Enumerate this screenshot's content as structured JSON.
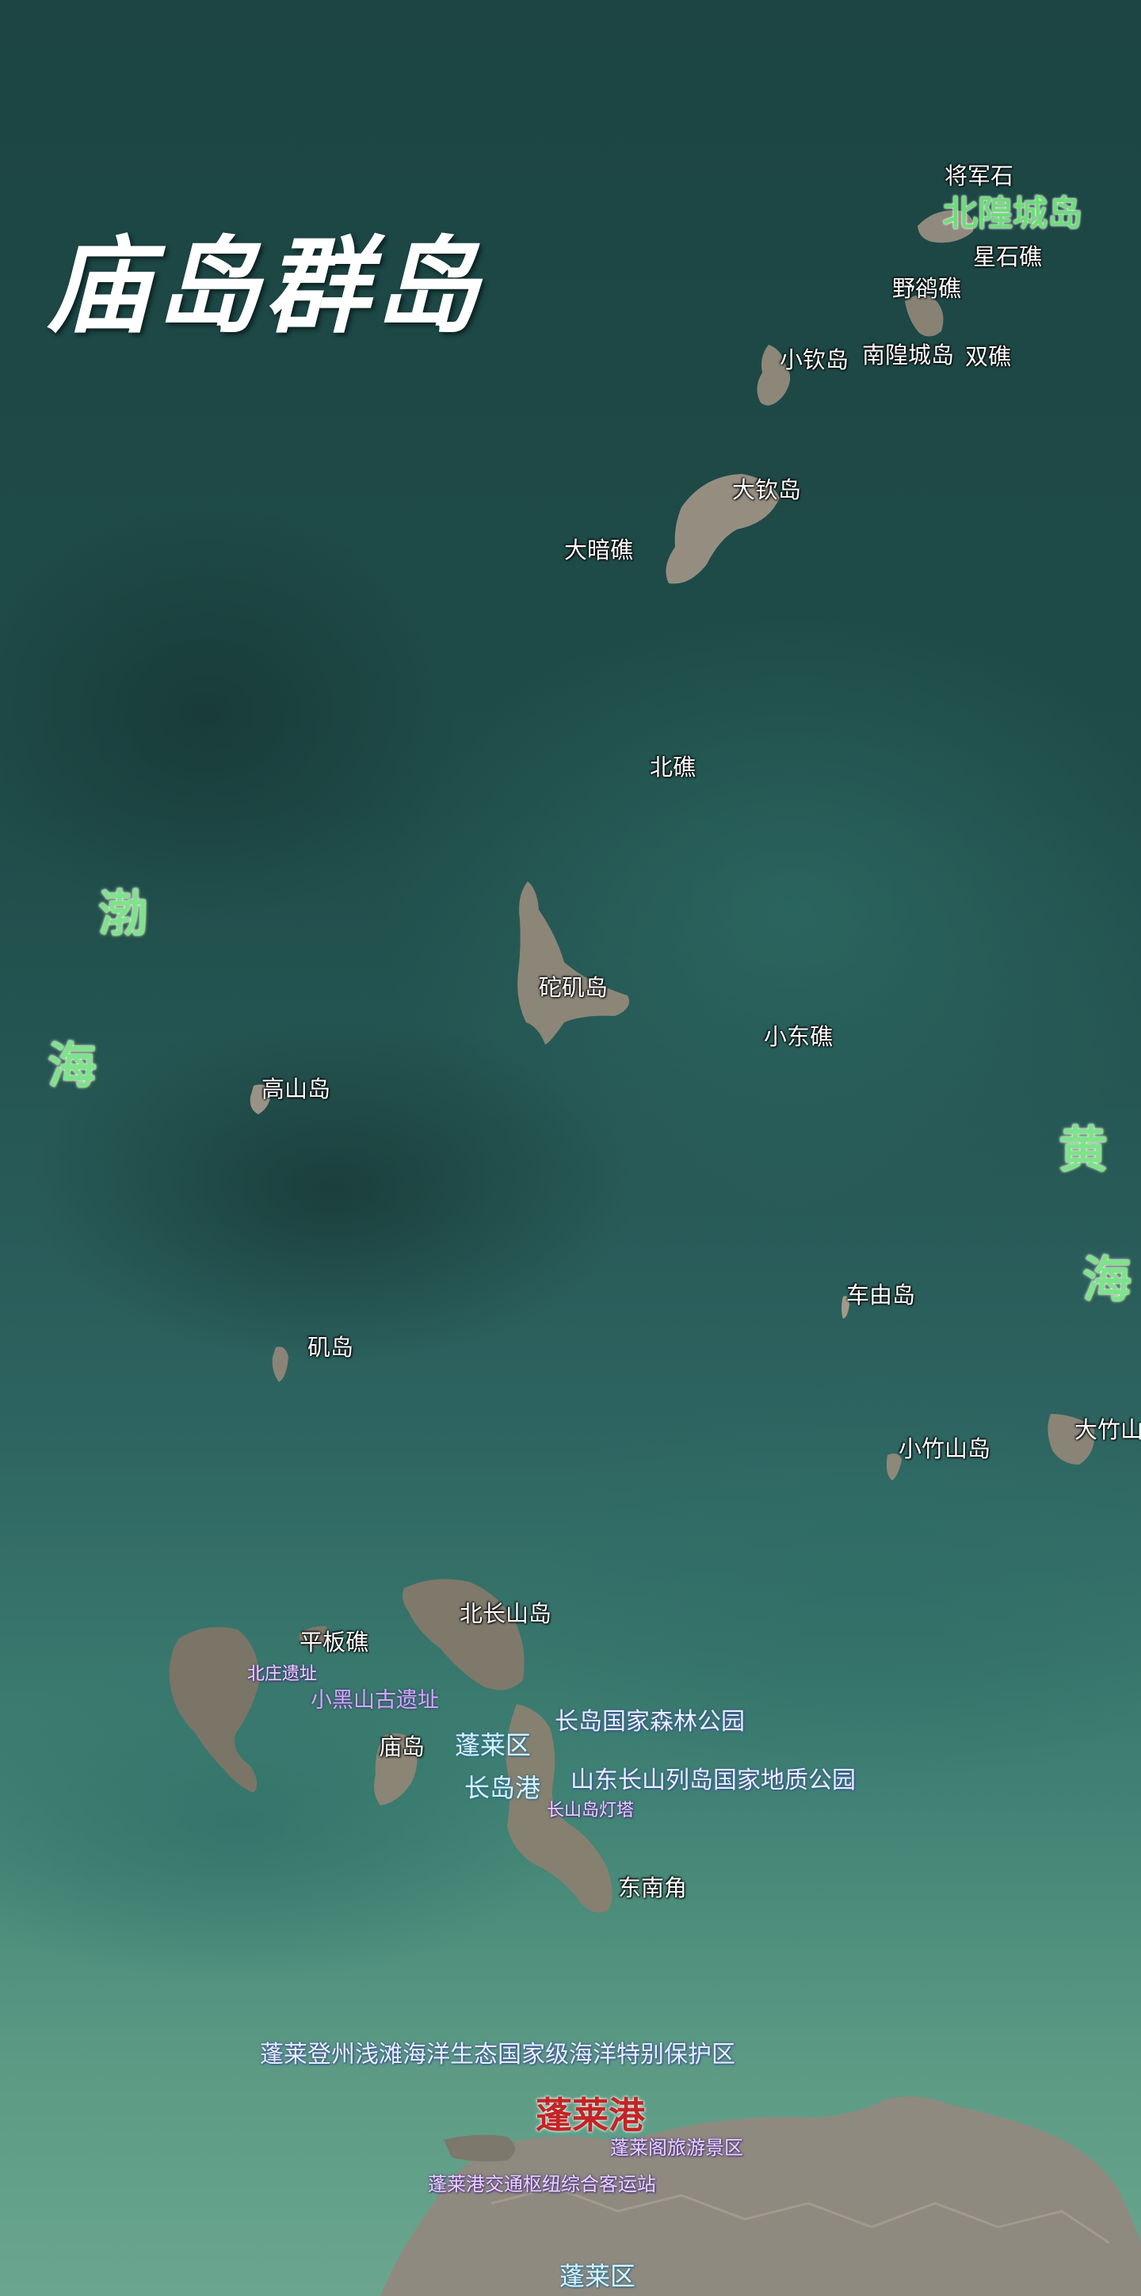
{
  "title": "庙岛群岛",
  "colors": {
    "sea_deep": "#1f4a47",
    "sea_shallow": "#4f8f7c",
    "land": "#8a8374",
    "sea_label": "#7ee38a",
    "port_label": "#c22525"
  },
  "seas": {
    "bohai_1": "渤",
    "bohai_2": "海",
    "yellow_1": "黄",
    "yellow_2": "海"
  },
  "highlight": {
    "beihuangcheng": "北隍城岛"
  },
  "places": {
    "jiangjunshi": "将军石",
    "xingshijiao": "星石礁",
    "yeluojiao": "野鹆礁",
    "xiaoqindao": "小钦岛",
    "nanhuangchengdao": "南隍城岛",
    "shuangjiao": "双礁",
    "daqindao": "大钦岛",
    "daanjiao": "大暗礁",
    "beijiao": "北礁",
    "tuojidao": "砣矶岛",
    "xiaodongjiao": "小东礁",
    "gaoshandao": "高山岛",
    "cheyoudao": "车由岛",
    "jidao": "矶岛",
    "xiaozhushandao": "小竹山岛",
    "dazhushan": "大竹山",
    "beichangshandao": "北长山岛",
    "pingbanjiao": "平板礁",
    "miaodao": "庙岛",
    "dongnanjiao": "东南角"
  },
  "zones": {
    "forest_park": "长岛国家森林公园",
    "geopark": "山东长山列岛国家地质公园",
    "reserve": "蓬莱登州浅滩海洋生态国家级海洋特别保护区"
  },
  "districts": {
    "penglai_upper": "蓬莱区",
    "changdao_port": "长岛港",
    "penglai_lower": "蓬莱区"
  },
  "history": {
    "xiaoheishan": "小黑山古遗址",
    "beizhuang": "北庄遗址",
    "tower": "长山岛灯塔"
  },
  "port": "蓬莱港",
  "small_labels": {
    "penglai_pavilion": "蓬莱阁旅游景区",
    "penglai_hub": "蓬莱港交通枢纽综合客运站"
  }
}
